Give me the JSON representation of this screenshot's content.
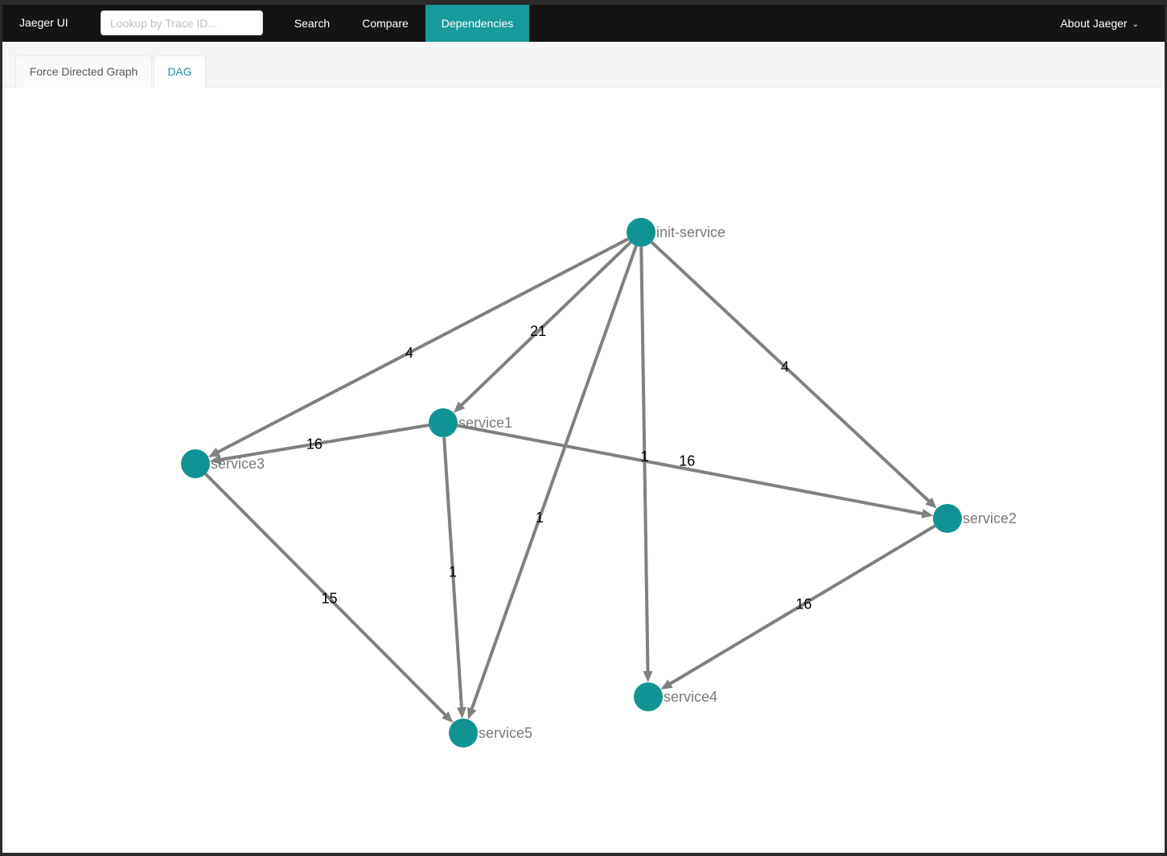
{
  "topnav": {
    "brand": "Jaeger UI",
    "search_placeholder": "Lookup by Trace ID...",
    "items": [
      {
        "label": "Search",
        "active": false
      },
      {
        "label": "Compare",
        "active": false
      },
      {
        "label": "Dependencies",
        "active": true
      }
    ],
    "about_label": "About Jaeger",
    "about_icon": "chevron-down-icon"
  },
  "tabs": [
    {
      "label": "Force Directed Graph",
      "active": false
    },
    {
      "label": "DAG",
      "active": true
    }
  ],
  "colors": {
    "accent": "#199a9a",
    "node": "#119393",
    "edge": "#808080",
    "nav_bg": "#141414"
  },
  "graph": {
    "nodes": [
      {
        "id": "init-service",
        "label": "init-service"
      },
      {
        "id": "service1",
        "label": "service1"
      },
      {
        "id": "service2",
        "label": "service2"
      },
      {
        "id": "service3",
        "label": "service3"
      },
      {
        "id": "service4",
        "label": "service4"
      },
      {
        "id": "service5",
        "label": "service5"
      }
    ],
    "edges": [
      {
        "from": "init-service",
        "to": "service3",
        "calls": "4"
      },
      {
        "from": "init-service",
        "to": "service1",
        "calls": "21"
      },
      {
        "from": "init-service",
        "to": "service5",
        "calls": "1"
      },
      {
        "from": "init-service",
        "to": "service4",
        "calls": "1"
      },
      {
        "from": "init-service",
        "to": "service2",
        "calls": "4"
      },
      {
        "from": "service1",
        "to": "service3",
        "calls": "16"
      },
      {
        "from": "service1",
        "to": "service2",
        "calls": "16"
      },
      {
        "from": "service1",
        "to": "service5",
        "calls": "1"
      },
      {
        "from": "service3",
        "to": "service5",
        "calls": "15"
      },
      {
        "from": "service2",
        "to": "service4",
        "calls": "16"
      }
    ]
  }
}
